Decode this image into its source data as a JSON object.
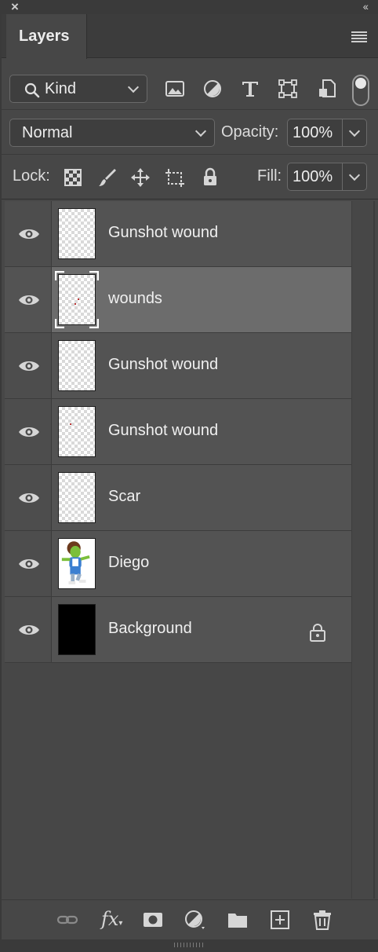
{
  "panel": {
    "tab_label": "Layers",
    "kind_filter": "Kind",
    "blend_mode": "Normal",
    "opacity_label": "Opacity:",
    "opacity_value": "100%",
    "lock_label": "Lock:",
    "fill_label": "Fill:",
    "fill_value": "100%"
  },
  "layers": [
    {
      "name": "Gunshot wound",
      "thumbnail": "transparent",
      "visible": true,
      "selected": false
    },
    {
      "name": "wounds",
      "thumbnail": "transparent",
      "visible": true,
      "selected": true
    },
    {
      "name": "Gunshot wound",
      "thumbnail": "transparent",
      "visible": true,
      "selected": false
    },
    {
      "name": "Gunshot wound",
      "thumbnail": "transparent",
      "visible": true,
      "selected": false
    },
    {
      "name": "Scar",
      "thumbnail": "transparent",
      "visible": true,
      "selected": false
    },
    {
      "name": "Diego",
      "thumbnail": "character-illustration",
      "visible": true,
      "selected": false
    },
    {
      "name": "Background",
      "thumbnail": "black",
      "visible": true,
      "selected": false,
      "locked": true
    }
  ],
  "icons": {
    "filters": [
      "image-filter-icon",
      "adjustment-filter-icon",
      "type-filter-icon",
      "shape-filter-icon",
      "smart-object-filter-icon"
    ],
    "locks": [
      "lock-transparent-pixels-icon",
      "lock-image-pixels-icon",
      "lock-position-icon",
      "lock-artboard-icon",
      "lock-all-icon"
    ],
    "bottom": [
      "link-layers-icon",
      "fx-icon",
      "add-mask-icon",
      "adjustment-layer-icon",
      "group-folder-icon",
      "new-layer-icon",
      "delete-icon"
    ]
  },
  "colors": {
    "panel_bg": "#474747",
    "row_bg": "#535353",
    "selected_row_bg": "#6c6c6c",
    "text": "#f0f0f0"
  }
}
